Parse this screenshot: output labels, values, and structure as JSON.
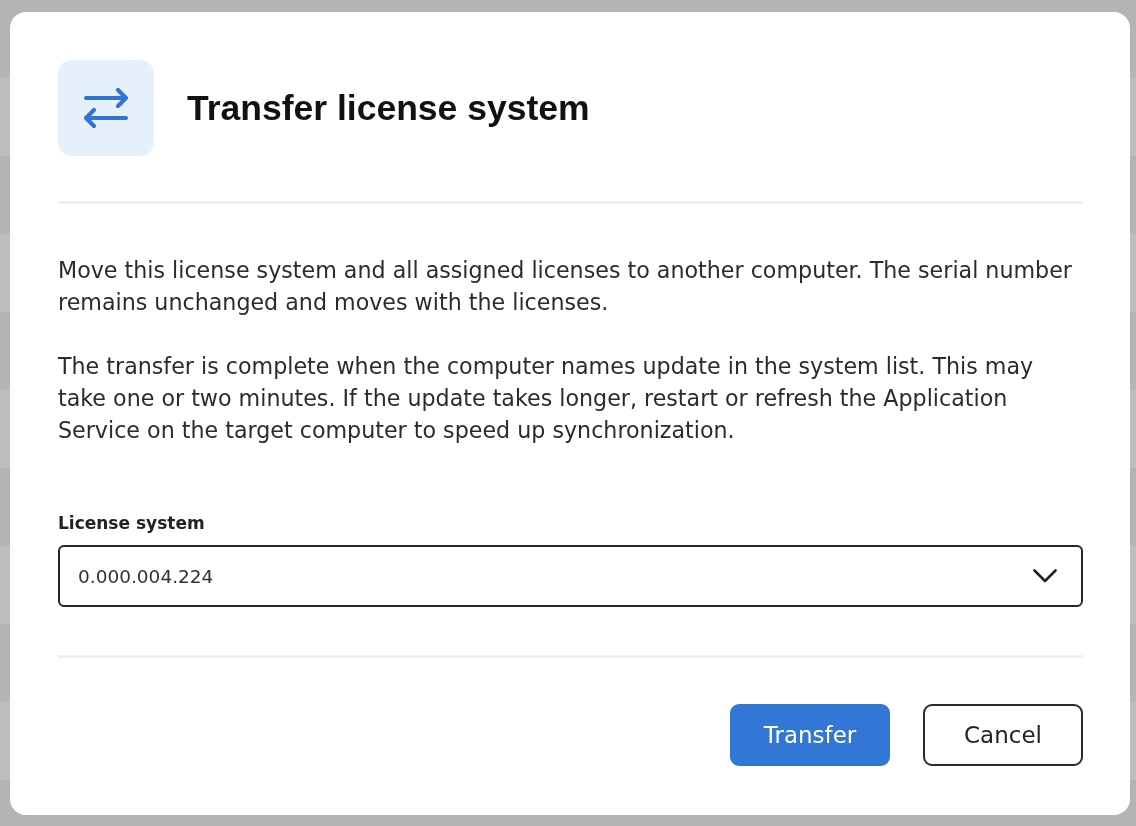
{
  "dialog": {
    "title": "Transfer license system",
    "paragraphs": [
      "Move this license system and all assigned licenses to another computer. The serial number remains unchanged and moves with the licenses.",
      "The transfer is complete when the computer names update in the system list. This may take one or two minutes. If the update takes longer, restart or refresh the Application Service on the target computer to speed up synchronization."
    ],
    "field": {
      "label": "License system",
      "value": "0.000.004.224"
    },
    "buttons": [
      {
        "label": "Transfer",
        "kind": "primary"
      },
      {
        "label": "Cancel",
        "kind": "secondary"
      }
    ]
  }
}
